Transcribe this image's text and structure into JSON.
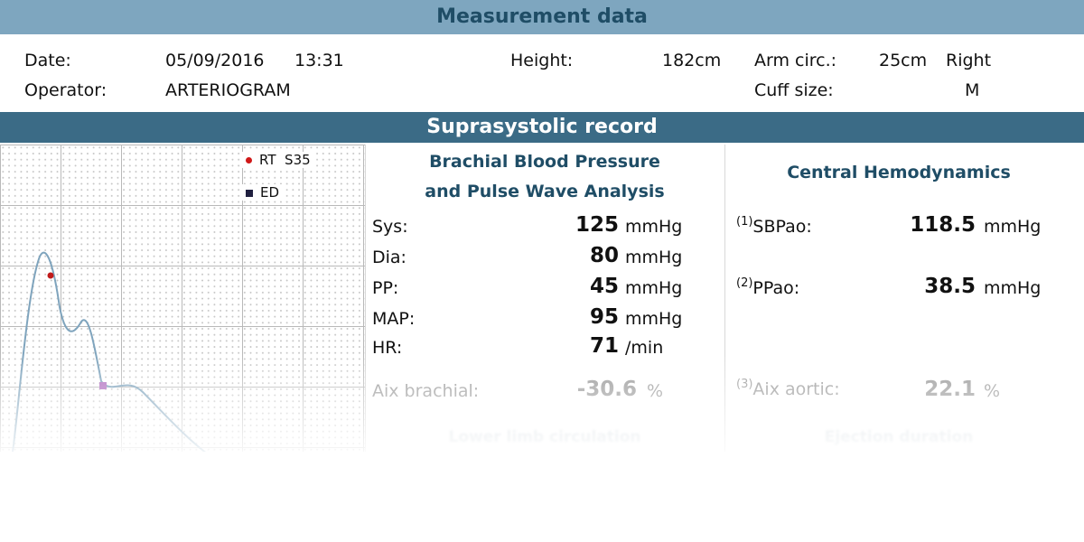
{
  "header": {
    "title": "Measurement data"
  },
  "measurement": {
    "date_label": "Date:",
    "date_value": "05/09/2016",
    "time_value": "13:31",
    "height_label": "Height:",
    "height_value": "182cm",
    "arm_label": "Arm circ.:",
    "arm_value": "25cm",
    "arm_side": "Right",
    "operator_label": "Operator:",
    "operator_value": "ARTERIOGRAM",
    "cuff_label": "Cuff size:",
    "cuff_value": "M"
  },
  "section": {
    "title": "Suprasystolic record"
  },
  "graph": {
    "legend_rt": "RT",
    "legend_s35": "S35",
    "legend_ed": "ED",
    "colors": {
      "curve": "#7fa4bd",
      "rt_marker": "#c01b1b",
      "ed_marker": "#b070c0"
    }
  },
  "brachial": {
    "title_line1": "Brachial Blood Pressure",
    "title_line2": "and Pulse Wave Analysis",
    "rows": [
      {
        "label": "Sys:",
        "value": "125",
        "unit": "mmHg"
      },
      {
        "label": "Dia:",
        "value": "80",
        "unit": "mmHg"
      },
      {
        "label": "PP:",
        "value": "45",
        "unit": "mmHg"
      },
      {
        "label": "MAP:",
        "value": "95",
        "unit": "mmHg"
      },
      {
        "label": "HR:",
        "value": "71",
        "unit": "/min"
      }
    ],
    "aix_label": "Aix brachial:",
    "aix_value": "-30.6",
    "aix_unit": "%",
    "lower_title": "Lower limb circulation"
  },
  "central": {
    "title": "Central Hemodynamics",
    "sbpao": {
      "sup": "(1)",
      "label": "SBPao:",
      "value": "118.5",
      "unit": "mmHg"
    },
    "ppao": {
      "sup": "(2)",
      "label": "PPao:",
      "value": "38.5",
      "unit": "mmHg"
    },
    "aix": {
      "sup": "(3)",
      "label": "Aix aortic:",
      "value": "22.1",
      "unit": "%"
    },
    "lower_title": "Ejection duration"
  }
}
